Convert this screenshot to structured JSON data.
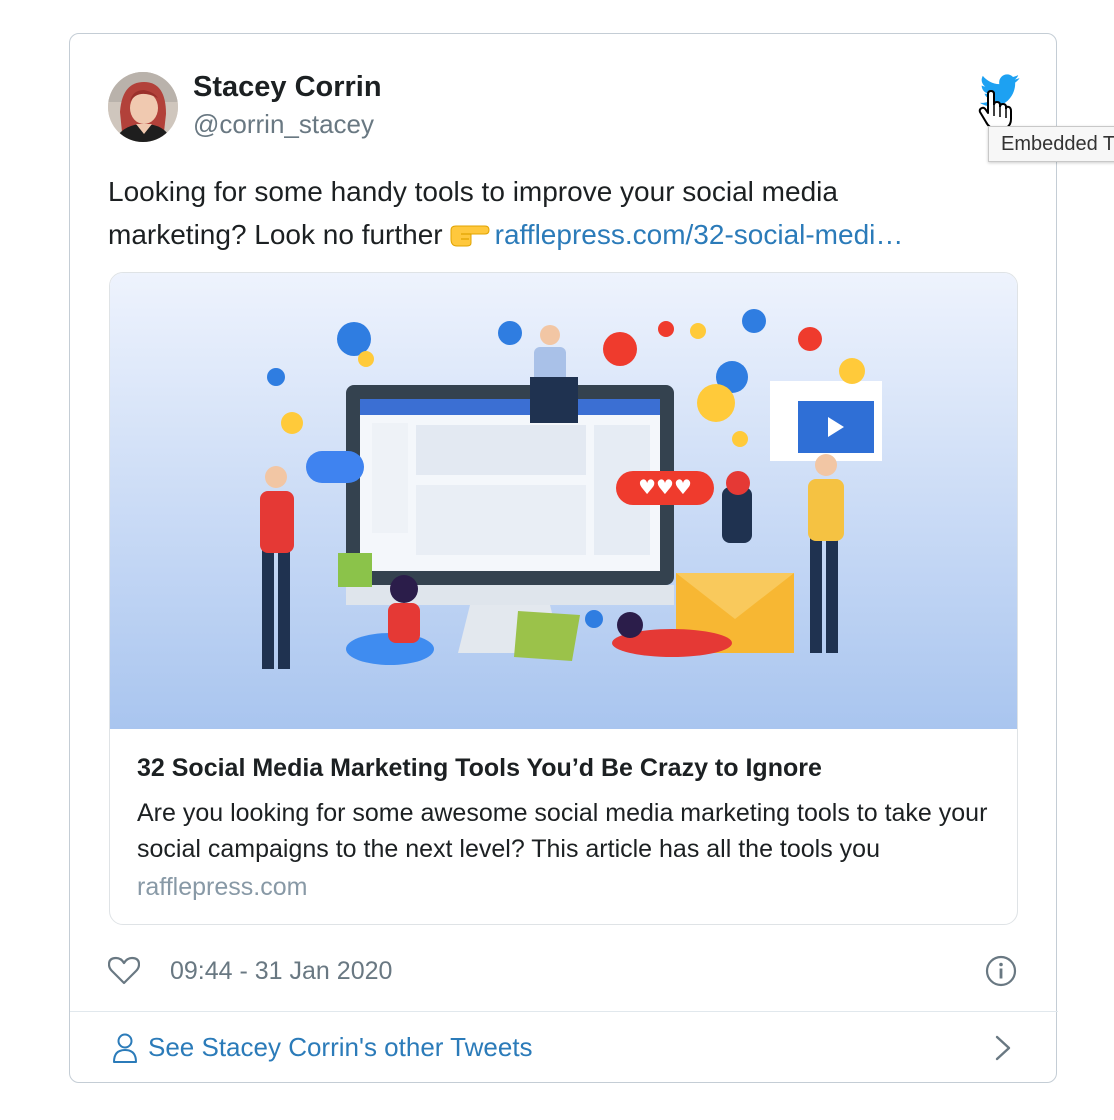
{
  "tweet": {
    "author_name": "Stacey Corrin",
    "author_handle": "@corrin_stacey",
    "text": "Looking for some handy tools to improve your social media marketing? Look no further",
    "text_line1": "Looking for some handy tools to improve your social media",
    "text_line2": "marketing? Look no further",
    "link_text": "rafflepress.com/32-social-medi…",
    "timestamp": "09:44 - 31 Jan 2020"
  },
  "card": {
    "title": "32 Social Media Marketing Tools You’d Be Crazy to Ignore",
    "description": "Are you looking for some awesome social media marketing tools to take your social campaigns to the next level? This article has all the tools you",
    "domain": "rafflepress.com"
  },
  "footer": {
    "label": "See Stacey Corrin's other Tweets"
  },
  "tooltip": {
    "text": "Embedded Tweet"
  },
  "icons": [
    "twitter-bird-icon",
    "hand-cursor-icon",
    "pointing-right-emoji-icon",
    "heart-icon",
    "info-icon",
    "person-icon",
    "chevron-right-icon"
  ],
  "colors": {
    "link": "#2b7bb9",
    "twitter_blue": "#1da1f2",
    "text": "#1c2022",
    "muted": "#697882",
    "card_domain": "#8899a6"
  }
}
